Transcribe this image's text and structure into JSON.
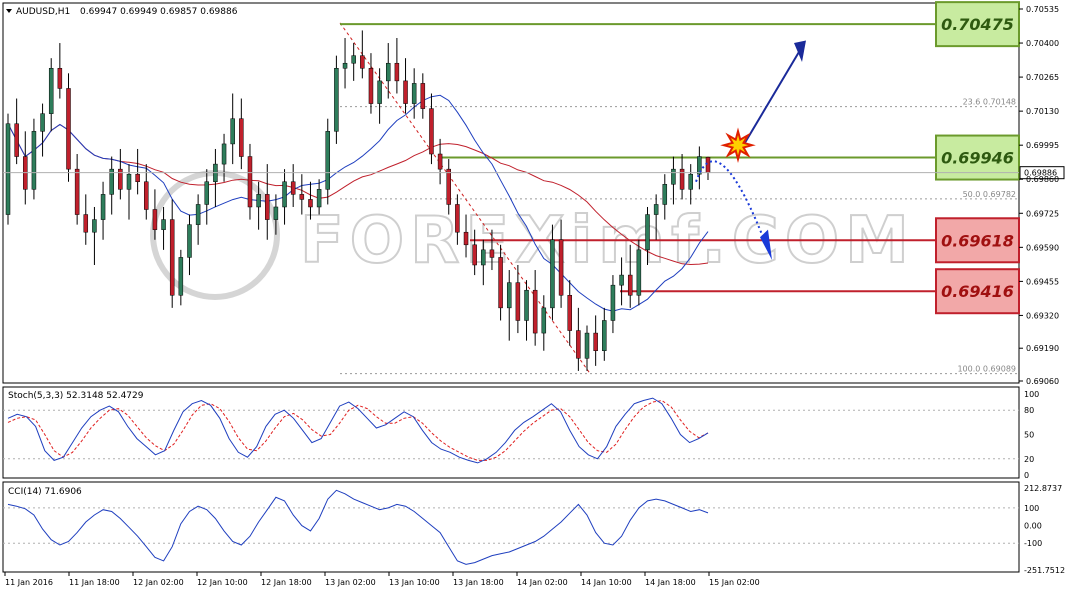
{
  "header": {
    "symbol": "AUDUSD,H1",
    "ohlc": "0.69947 0.69949 0.69857 0.69886"
  },
  "watermark": "FOREXimf.COM",
  "colors": {
    "bull": "#2e7d5b",
    "bear": "#c0202c",
    "blue_ma": "#1f3fbf",
    "red_ma": "#c0202c",
    "resistance": "#6b9a2c",
    "support": "#c0202c"
  },
  "price_axis_labels": [
    "0.70535",
    "0.70400",
    "0.70265",
    "0.70130",
    "0.69995",
    "0.69860",
    "0.69725",
    "0.69590",
    "0.69455",
    "0.69320",
    "0.69190",
    "0.69060"
  ],
  "current_price": "0.69886",
  "levels": [
    {
      "name": "resistance-2",
      "value": 0.70475,
      "label": "0.70475",
      "kind": "resistance"
    },
    {
      "name": "resistance-1",
      "value": 0.69946,
      "label": "0.69946",
      "kind": "resistance"
    },
    {
      "name": "support-1",
      "value": 0.69618,
      "label": "0.69618",
      "kind": "support"
    },
    {
      "name": "support-2",
      "value": 0.69416,
      "label": "0.69416",
      "kind": "support"
    }
  ],
  "fibonacci": [
    {
      "label": "23.6  0.70148",
      "value": 0.70148
    },
    {
      "label": "50.0  0.69782",
      "value": 0.69782
    },
    {
      "label": "100.0  0.69089",
      "value": 0.69089
    }
  ],
  "time_labels": [
    "11 Jan 2016",
    "11 Jan 18:00",
    "12 Jan 02:00",
    "12 Jan 10:00",
    "12 Jan 18:00",
    "13 Jan 02:00",
    "13 Jan 10:00",
    "13 Jan 18:00",
    "14 Jan 02:00",
    "14 Jan 10:00",
    "14 Jan 18:00",
    "15 Jan 02:00"
  ],
  "stoch": {
    "title": "Stoch(5,3,3) 52.3148 52.4729",
    "axis": [
      "100",
      "80",
      "50",
      "20",
      "0"
    ]
  },
  "cci": {
    "title": "CCI(14) 71.6906",
    "axis": [
      "212.8737",
      "100",
      "0.00",
      "-100",
      "-251.7512"
    ]
  },
  "chart_data": {
    "type": "candlestick",
    "title": "AUDUSD,H1",
    "ylim": [
      0.6906,
      0.70535
    ],
    "candles": [
      {
        "o": 0.6972,
        "h": 0.7012,
        "l": 0.6968,
        "c": 0.7008
      },
      {
        "o": 0.7008,
        "h": 0.7018,
        "l": 0.6992,
        "c": 0.6995
      },
      {
        "o": 0.6995,
        "h": 0.7005,
        "l": 0.6976,
        "c": 0.6982
      },
      {
        "o": 0.6982,
        "h": 0.701,
        "l": 0.6978,
        "c": 0.7005
      },
      {
        "o": 0.7005,
        "h": 0.7016,
        "l": 0.6995,
        "c": 0.7012
      },
      {
        "o": 0.7012,
        "h": 0.7034,
        "l": 0.7005,
        "c": 0.703
      },
      {
        "o": 0.703,
        "h": 0.704,
        "l": 0.7018,
        "c": 0.7022
      },
      {
        "o": 0.7022,
        "h": 0.7028,
        "l": 0.6985,
        "c": 0.699
      },
      {
        "o": 0.699,
        "h": 0.6996,
        "l": 0.6968,
        "c": 0.6972
      },
      {
        "o": 0.6972,
        "h": 0.698,
        "l": 0.696,
        "c": 0.6965
      },
      {
        "o": 0.6965,
        "h": 0.6975,
        "l": 0.6952,
        "c": 0.697
      },
      {
        "o": 0.697,
        "h": 0.6985,
        "l": 0.6962,
        "c": 0.698
      },
      {
        "o": 0.698,
        "h": 0.6995,
        "l": 0.6972,
        "c": 0.699
      },
      {
        "o": 0.699,
        "h": 0.6998,
        "l": 0.6978,
        "c": 0.6982
      },
      {
        "o": 0.6982,
        "h": 0.6992,
        "l": 0.697,
        "c": 0.6988
      },
      {
        "o": 0.6988,
        "h": 0.6998,
        "l": 0.698,
        "c": 0.6985
      },
      {
        "o": 0.6985,
        "h": 0.6992,
        "l": 0.697,
        "c": 0.6974
      },
      {
        "o": 0.6974,
        "h": 0.6982,
        "l": 0.6962,
        "c": 0.6966
      },
      {
        "o": 0.6966,
        "h": 0.6975,
        "l": 0.6958,
        "c": 0.697
      },
      {
        "o": 0.697,
        "h": 0.6978,
        "l": 0.6935,
        "c": 0.694
      },
      {
        "o": 0.694,
        "h": 0.6958,
        "l": 0.6936,
        "c": 0.6955
      },
      {
        "o": 0.6955,
        "h": 0.6972,
        "l": 0.6948,
        "c": 0.6968
      },
      {
        "o": 0.6968,
        "h": 0.698,
        "l": 0.696,
        "c": 0.6976
      },
      {
        "o": 0.6976,
        "h": 0.699,
        "l": 0.6968,
        "c": 0.6985
      },
      {
        "o": 0.6985,
        "h": 0.6998,
        "l": 0.6975,
        "c": 0.6992
      },
      {
        "o": 0.6992,
        "h": 0.7004,
        "l": 0.6985,
        "c": 0.7
      },
      {
        "o": 0.7,
        "h": 0.702,
        "l": 0.6992,
        "c": 0.701
      },
      {
        "o": 0.701,
        "h": 0.7018,
        "l": 0.699,
        "c": 0.6995
      },
      {
        "o": 0.6995,
        "h": 0.7,
        "l": 0.697,
        "c": 0.6975
      },
      {
        "o": 0.6975,
        "h": 0.6985,
        "l": 0.6966,
        "c": 0.698
      },
      {
        "o": 0.698,
        "h": 0.6992,
        "l": 0.6962,
        "c": 0.697
      },
      {
        "o": 0.697,
        "h": 0.698,
        "l": 0.6964,
        "c": 0.6975
      },
      {
        "o": 0.6975,
        "h": 0.699,
        "l": 0.6968,
        "c": 0.6985
      },
      {
        "o": 0.6985,
        "h": 0.6992,
        "l": 0.6975,
        "c": 0.698
      },
      {
        "o": 0.698,
        "h": 0.6988,
        "l": 0.6972,
        "c": 0.6978
      },
      {
        "o": 0.6978,
        "h": 0.6985,
        "l": 0.697,
        "c": 0.6975
      },
      {
        "o": 0.6975,
        "h": 0.6986,
        "l": 0.6972,
        "c": 0.6982
      },
      {
        "o": 0.6982,
        "h": 0.701,
        "l": 0.6976,
        "c": 0.7005
      },
      {
        "o": 0.7005,
        "h": 0.7035,
        "l": 0.7,
        "c": 0.703
      },
      {
        "o": 0.703,
        "h": 0.7042,
        "l": 0.7022,
        "c": 0.7032
      },
      {
        "o": 0.7032,
        "h": 0.704,
        "l": 0.7025,
        "c": 0.7035
      },
      {
        "o": 0.7035,
        "h": 0.7045,
        "l": 0.7026,
        "c": 0.703
      },
      {
        "o": 0.703,
        "h": 0.7036,
        "l": 0.7012,
        "c": 0.7016
      },
      {
        "o": 0.7016,
        "h": 0.703,
        "l": 0.7008,
        "c": 0.7025
      },
      {
        "o": 0.7025,
        "h": 0.704,
        "l": 0.7018,
        "c": 0.7032
      },
      {
        "o": 0.7032,
        "h": 0.7042,
        "l": 0.702,
        "c": 0.7025
      },
      {
        "o": 0.7025,
        "h": 0.7034,
        "l": 0.7012,
        "c": 0.7016
      },
      {
        "o": 0.7016,
        "h": 0.703,
        "l": 0.701,
        "c": 0.7024
      },
      {
        "o": 0.7024,
        "h": 0.7028,
        "l": 0.701,
        "c": 0.7014
      },
      {
        "o": 0.7014,
        "h": 0.702,
        "l": 0.6992,
        "c": 0.6996
      },
      {
        "o": 0.6996,
        "h": 0.7002,
        "l": 0.6984,
        "c": 0.699
      },
      {
        "o": 0.699,
        "h": 0.6994,
        "l": 0.6972,
        "c": 0.6976
      },
      {
        "o": 0.6976,
        "h": 0.698,
        "l": 0.696,
        "c": 0.6965
      },
      {
        "o": 0.6965,
        "h": 0.6972,
        "l": 0.6955,
        "c": 0.696
      },
      {
        "o": 0.696,
        "h": 0.6966,
        "l": 0.6948,
        "c": 0.6952
      },
      {
        "o": 0.6952,
        "h": 0.6962,
        "l": 0.6944,
        "c": 0.6958
      },
      {
        "o": 0.6958,
        "h": 0.6966,
        "l": 0.695,
        "c": 0.6955
      },
      {
        "o": 0.6955,
        "h": 0.696,
        "l": 0.693,
        "c": 0.6935
      },
      {
        "o": 0.6935,
        "h": 0.695,
        "l": 0.6922,
        "c": 0.6945
      },
      {
        "o": 0.6945,
        "h": 0.6952,
        "l": 0.6925,
        "c": 0.693
      },
      {
        "o": 0.693,
        "h": 0.6946,
        "l": 0.6922,
        "c": 0.6942
      },
      {
        "o": 0.6942,
        "h": 0.695,
        "l": 0.692,
        "c": 0.6925
      },
      {
        "o": 0.6925,
        "h": 0.694,
        "l": 0.6918,
        "c": 0.6935
      },
      {
        "o": 0.6935,
        "h": 0.6968,
        "l": 0.693,
        "c": 0.6962
      },
      {
        "o": 0.6962,
        "h": 0.697,
        "l": 0.6935,
        "c": 0.694
      },
      {
        "o": 0.694,
        "h": 0.6946,
        "l": 0.692,
        "c": 0.6926
      },
      {
        "o": 0.6926,
        "h": 0.6935,
        "l": 0.691,
        "c": 0.6915
      },
      {
        "o": 0.6915,
        "h": 0.6928,
        "l": 0.691,
        "c": 0.6925
      },
      {
        "o": 0.6925,
        "h": 0.6932,
        "l": 0.6912,
        "c": 0.6918
      },
      {
        "o": 0.6918,
        "h": 0.6935,
        "l": 0.6914,
        "c": 0.693
      },
      {
        "o": 0.693,
        "h": 0.6948,
        "l": 0.6925,
        "c": 0.6944
      },
      {
        "o": 0.6944,
        "h": 0.6955,
        "l": 0.6936,
        "c": 0.6948
      },
      {
        "o": 0.6948,
        "h": 0.696,
        "l": 0.6935,
        "c": 0.694
      },
      {
        "o": 0.694,
        "h": 0.6962,
        "l": 0.6936,
        "c": 0.6958
      },
      {
        "o": 0.6958,
        "h": 0.6975,
        "l": 0.6952,
        "c": 0.6972
      },
      {
        "o": 0.6972,
        "h": 0.698,
        "l": 0.6962,
        "c": 0.6976
      },
      {
        "o": 0.6976,
        "h": 0.6988,
        "l": 0.697,
        "c": 0.6984
      },
      {
        "o": 0.6984,
        "h": 0.6995,
        "l": 0.6976,
        "c": 0.699
      },
      {
        "o": 0.699,
        "h": 0.6996,
        "l": 0.6978,
        "c": 0.6982
      },
      {
        "o": 0.6982,
        "h": 0.6992,
        "l": 0.6976,
        "c": 0.6988
      },
      {
        "o": 0.6988,
        "h": 0.6999,
        "l": 0.6982,
        "c": 0.6995
      },
      {
        "o": 0.69947,
        "h": 0.69949,
        "l": 0.69857,
        "c": 0.69886
      }
    ],
    "stoch_main": [
      70,
      75,
      72,
      60,
      30,
      18,
      22,
      40,
      58,
      72,
      80,
      85,
      78,
      60,
      45,
      35,
      25,
      30,
      55,
      78,
      88,
      92,
      86,
      70,
      45,
      28,
      22,
      35,
      60,
      75,
      80,
      70,
      55,
      40,
      45,
      65,
      85,
      90,
      82,
      70,
      58,
      62,
      70,
      78,
      72,
      55,
      40,
      32,
      28,
      22,
      18,
      15,
      20,
      28,
      40,
      55,
      65,
      72,
      80,
      88,
      78,
      55,
      35,
      25,
      20,
      35,
      60,
      75,
      88,
      92,
      95,
      88,
      70,
      50,
      40,
      45,
      52
    ],
    "stoch_signal": [
      65,
      70,
      72,
      68,
      50,
      30,
      22,
      28,
      42,
      58,
      70,
      80,
      82,
      74,
      60,
      46,
      36,
      30,
      38,
      55,
      74,
      86,
      88,
      82,
      66,
      46,
      32,
      30,
      42,
      58,
      72,
      76,
      68,
      56,
      48,
      50,
      64,
      80,
      86,
      82,
      72,
      64,
      64,
      70,
      72,
      64,
      52,
      42,
      34,
      28,
      22,
      18,
      18,
      22,
      30,
      42,
      54,
      64,
      72,
      80,
      82,
      72,
      56,
      40,
      30,
      28,
      38,
      56,
      72,
      84,
      90,
      92,
      84,
      68,
      54,
      46,
      52
    ],
    "cci_main": [
      120,
      110,
      95,
      60,
      -20,
      -80,
      -110,
      -90,
      -40,
      20,
      60,
      90,
      80,
      40,
      -10,
      -60,
      -120,
      -180,
      -200,
      -120,
      10,
      80,
      110,
      90,
      40,
      -30,
      -90,
      -110,
      -60,
      20,
      90,
      160,
      140,
      60,
      0,
      -30,
      40,
      150,
      200,
      180,
      150,
      130,
      110,
      90,
      100,
      120,
      110,
      80,
      40,
      0,
      -40,
      -120,
      -200,
      -220,
      -210,
      -190,
      -170,
      -160,
      -150,
      -130,
      -110,
      -90,
      -60,
      -20,
      20,
      70,
      120,
      60,
      -40,
      -100,
      -110,
      -60,
      30,
      100,
      140,
      150,
      140,
      120,
      100,
      80,
      90,
      72
    ]
  }
}
